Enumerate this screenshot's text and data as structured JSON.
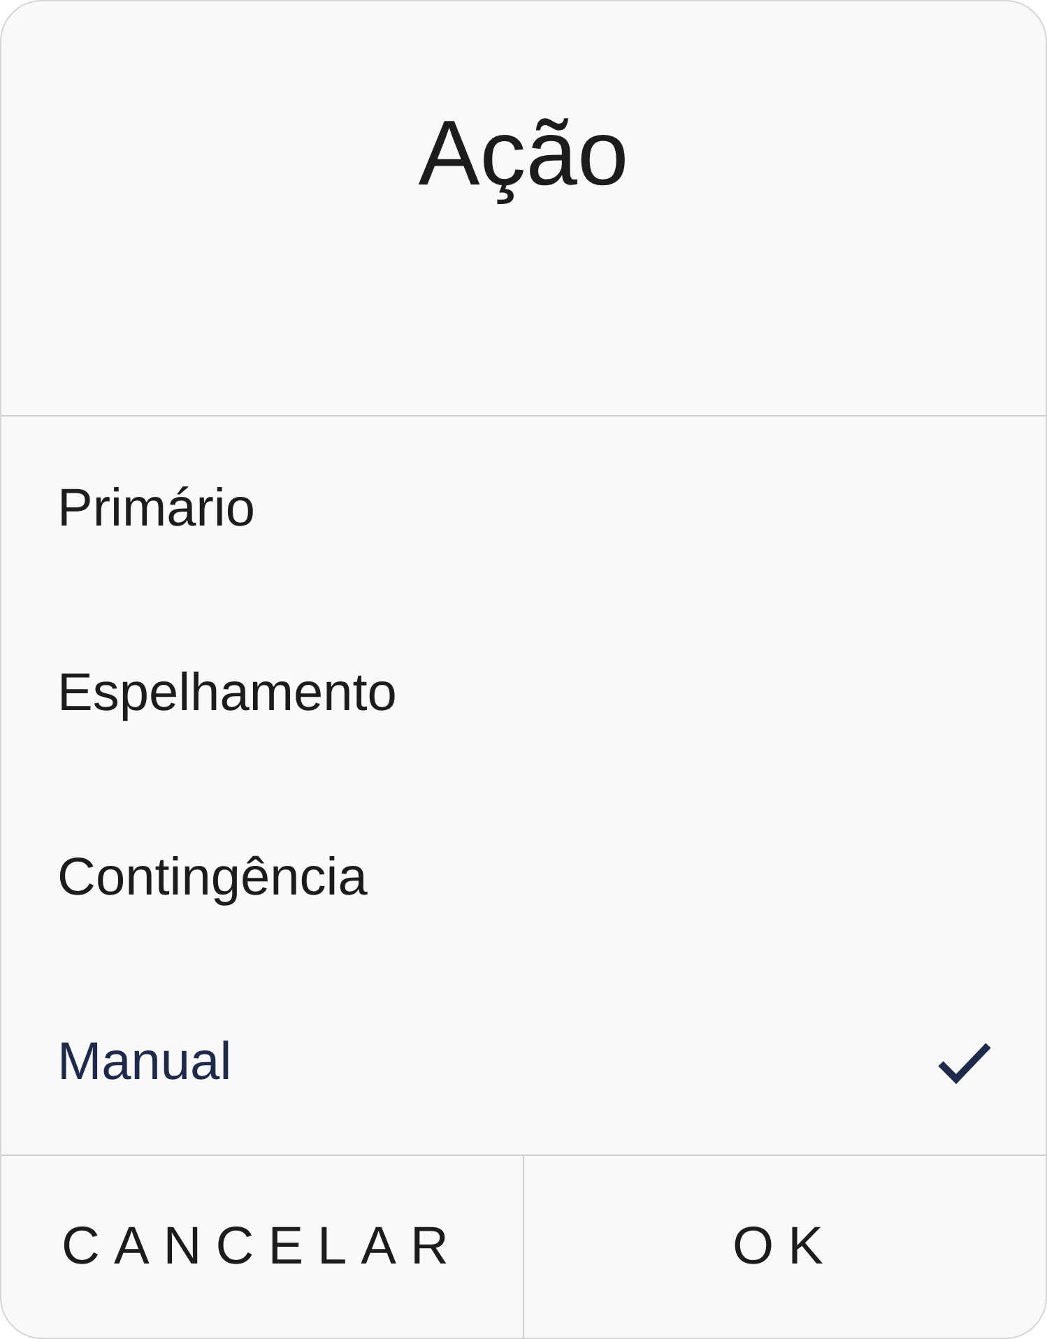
{
  "dialog": {
    "title": "Ação"
  },
  "options": [
    {
      "label": "Primário",
      "selected": false
    },
    {
      "label": "Espelhamento",
      "selected": false
    },
    {
      "label": "Contingência",
      "selected": false
    },
    {
      "label": "Manual",
      "selected": true
    }
  ],
  "buttons": [
    "CANCELAR",
    "OK"
  ]
}
